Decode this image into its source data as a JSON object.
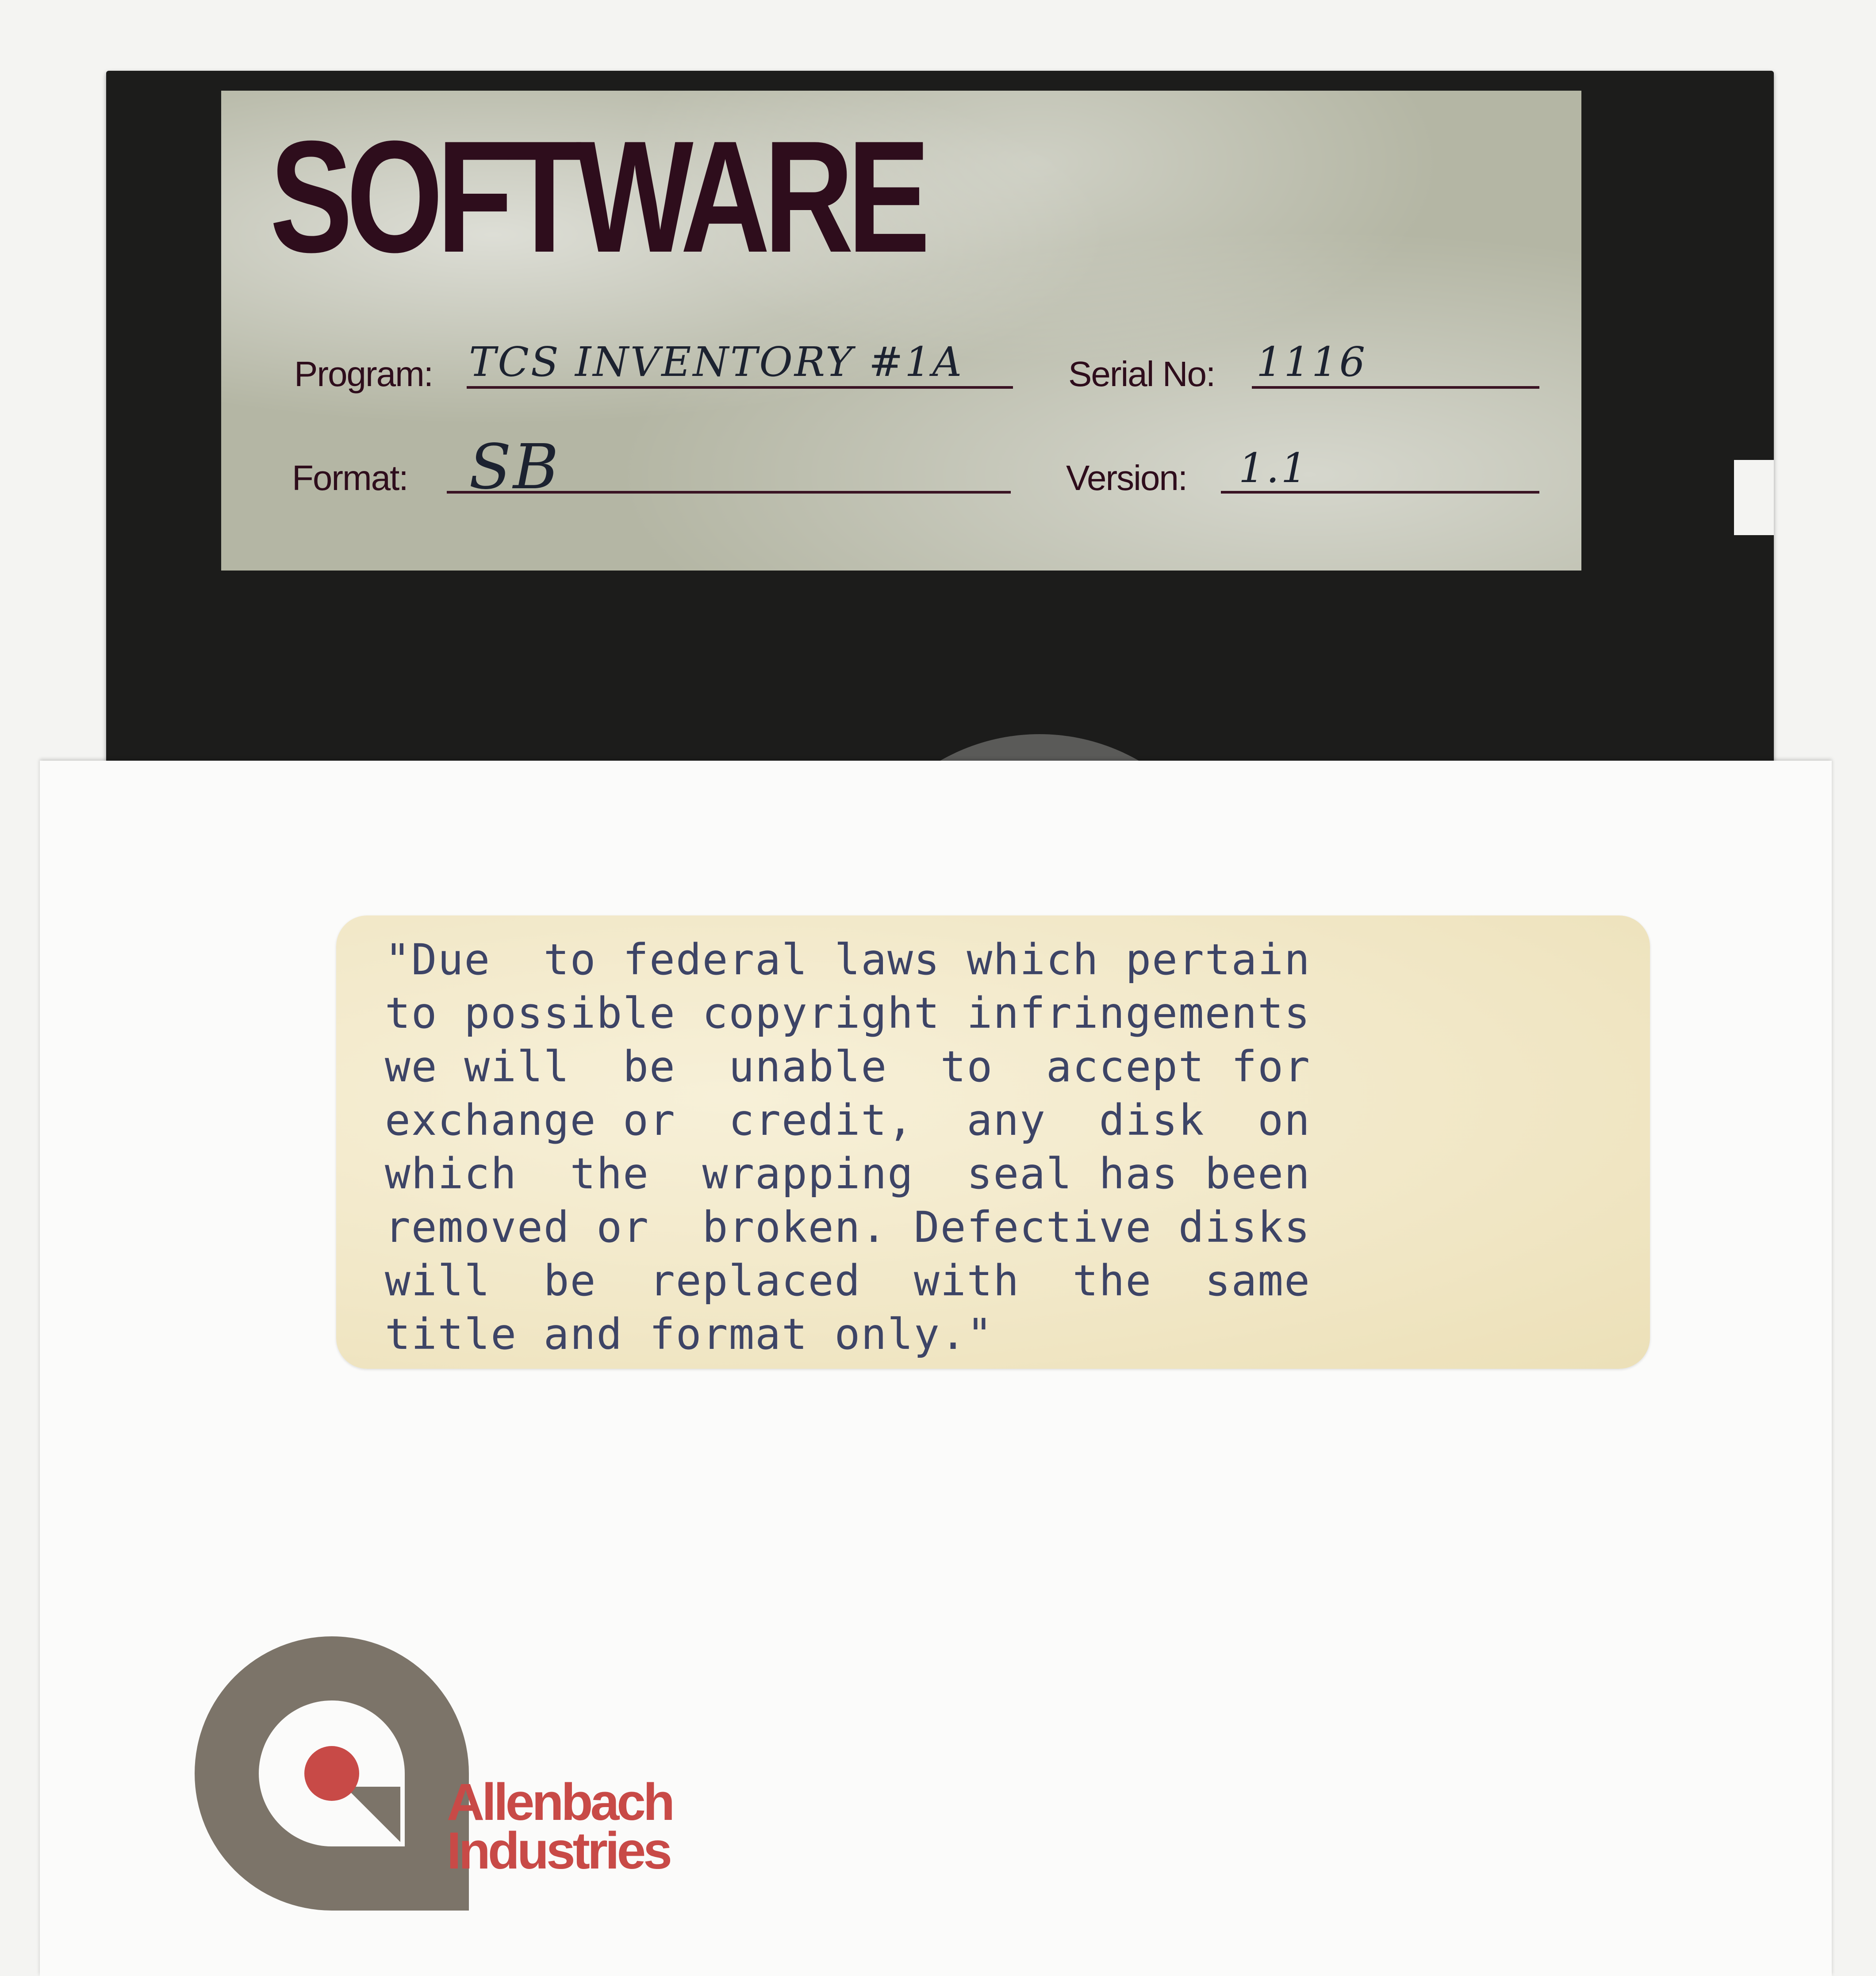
{
  "label": {
    "title": "SOFTWARE",
    "program_label": "Program:",
    "program_value": "TCS INVENTORY #1A",
    "serial_label": "Serial No:",
    "serial_value": "1116",
    "format_label": "Format:",
    "format_value": "SB",
    "version_label": "Version:",
    "version_value": "1.1"
  },
  "notice": {
    "lines": [
      "\"Due  to federal laws which pertain",
      "to possible copyright infringements",
      "we will  be  unable  to  accept for",
      "exchange or  credit,  any  disk  on",
      "which  the  wrapping  seal has been",
      "removed or  broken. Defective disks",
      "will  be  replaced  with  the  same",
      "title and format only.\""
    ]
  },
  "brand": {
    "line1": "Allenbach",
    "line2": "Industries"
  },
  "colors": {
    "label_ink": "#2e0d1c",
    "label_bg": "#b4b6a4",
    "notice_text": "#3d4466",
    "brand_red": "#c84a47",
    "logo_gray": "#7c7469"
  }
}
